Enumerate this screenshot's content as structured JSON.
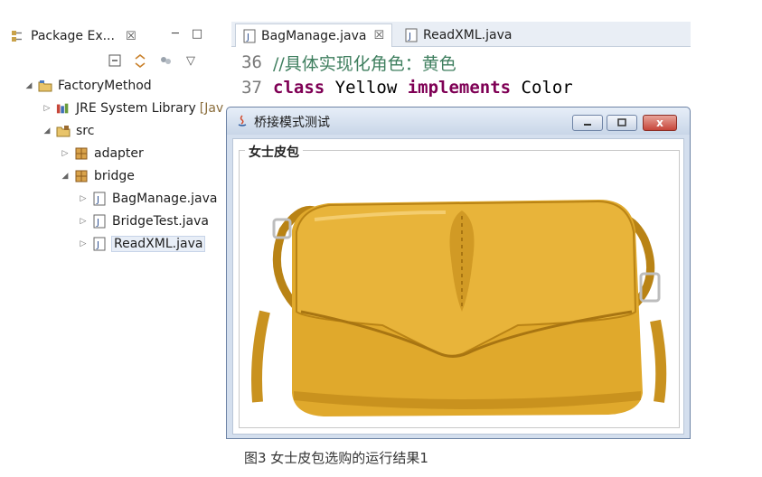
{
  "package_explorer": {
    "tab_label": "Package Ex...",
    "close_glyph": "☒",
    "tree": [
      {
        "label": "FactoryMethod",
        "icon": "project-folder-icon",
        "expanded": true,
        "level": 0
      },
      {
        "label": "JRE System Library",
        "suffix": "[Jav",
        "icon": "library-icon",
        "expanded": false,
        "level": 1
      },
      {
        "label": "src",
        "icon": "source-folder-icon",
        "expanded": true,
        "level": 1
      },
      {
        "label": "adapter",
        "icon": "package-icon",
        "expanded": false,
        "level": 2
      },
      {
        "label": "bridge",
        "icon": "package-icon",
        "expanded": true,
        "level": 2
      },
      {
        "label": "BagManage.java",
        "icon": "java-file-icon",
        "expanded": false,
        "level": 3
      },
      {
        "label": "BridgeTest.java",
        "icon": "java-file-icon",
        "expanded": false,
        "level": 3
      },
      {
        "label": "ReadXML.java",
        "icon": "java-file-icon",
        "expanded": false,
        "level": 3,
        "selected": true
      }
    ]
  },
  "editor": {
    "tabs": [
      {
        "label": "BagManage.java",
        "active": true,
        "closable": true
      },
      {
        "label": "ReadXML.java",
        "active": false,
        "closable": false
      }
    ],
    "lines": [
      {
        "number": "36",
        "comment": "//具体实现化角色：黄色"
      },
      {
        "number": "37",
        "kw1": "class",
        "name": " Yellow ",
        "kw2": "implements",
        "rest": " Color"
      }
    ]
  },
  "window": {
    "title": "桥接模式测试",
    "group_label": "女士皮包",
    "image_subject": "yellow-leather-handbag",
    "close_glyph": "x"
  },
  "caption": "图3 女士皮包选购的运行结果1",
  "colors": {
    "keyword": "#7f0055",
    "comment": "#3f7f5f",
    "bag_main": "#e0a92c",
    "bag_shadow": "#b98315"
  }
}
